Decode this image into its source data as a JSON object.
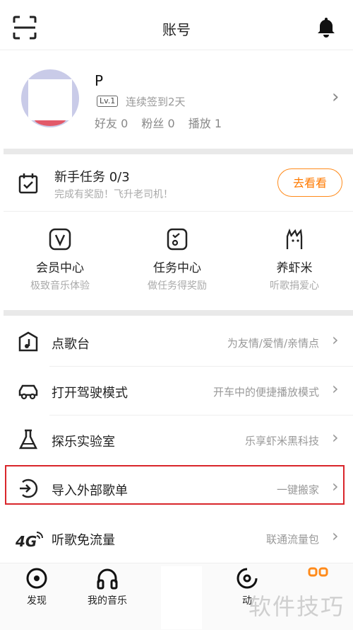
{
  "header": {
    "title": "账号"
  },
  "profile": {
    "name": "P",
    "level": "Lv.1",
    "checkin": "连续签到2天",
    "friends": "好友 0",
    "fans": "粉丝 0",
    "plays": "播放 1"
  },
  "task": {
    "title": "新手任务 0/3",
    "subtitle": "完成有奖励！飞升老司机！",
    "button": "去看看"
  },
  "features": [
    {
      "title": "会员中心",
      "subtitle": "极致音乐体验",
      "icon": "vip-icon"
    },
    {
      "title": "任务中心",
      "subtitle": "做任务得奖励",
      "icon": "task-center-icon"
    },
    {
      "title": "养虾米",
      "subtitle": "听歌捐爱心",
      "icon": "shrimp-icon"
    }
  ],
  "list": [
    {
      "label": "点歌台",
      "right": "为友情/爱情/亲情点",
      "icon": "song-request-icon"
    },
    {
      "label": "打开驾驶模式",
      "right": "开车中的便捷播放模式",
      "icon": "car-icon"
    },
    {
      "label": "探乐实验室",
      "right": "乐享虾米黑科技",
      "icon": "lab-flask-icon"
    },
    {
      "label": "导入外部歌单",
      "right": "一键搬家",
      "icon": "import-icon"
    },
    {
      "label": "听歌免流量",
      "right": "联通流量包",
      "icon": "4g-icon"
    }
  ],
  "tabs": [
    {
      "label": "发现",
      "icon": "discover-icon"
    },
    {
      "label": "我的音乐",
      "icon": "headphones-icon"
    },
    {
      "label": "动",
      "icon": "dynamic-icon"
    },
    {
      "label": "",
      "icon": "grid-icon"
    }
  ],
  "watermark": "软件技巧",
  "colors": {
    "accent": "#ff7a00",
    "highlight": "#d9262b"
  }
}
